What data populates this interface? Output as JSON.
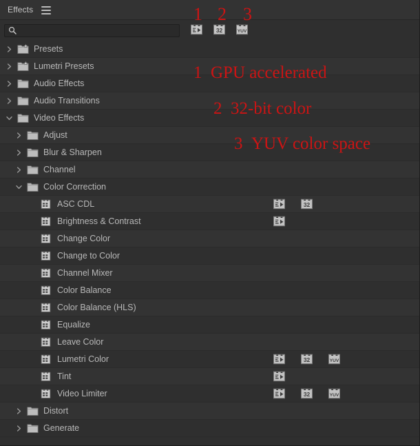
{
  "panel": {
    "title": "Effects",
    "menu_icon": "hamburger-menu-icon"
  },
  "search": {
    "value": "",
    "placeholder": "",
    "icon": "search-icon"
  },
  "filter_buttons": [
    {
      "id": "gpu",
      "icon": "gpu-accelerated-icon",
      "label": "GPU accelerated"
    },
    {
      "id": "bit32",
      "icon": "32-bit-color-icon",
      "label": "32-bit color"
    },
    {
      "id": "yuv",
      "icon": "yuv-color-space-icon",
      "label": "YUV color space"
    }
  ],
  "annotations": {
    "numbers": [
      "1",
      "2",
      "3"
    ],
    "lines": [
      {
        "num": "1",
        "text": "GPU accelerated"
      },
      {
        "num": "2",
        "text": "32-bit color"
      },
      {
        "num": "3",
        "text": "YUV color space"
      }
    ],
    "color": "#cc1414"
  },
  "tree": [
    {
      "label": "Presets",
      "kind": "preset-folder",
      "indent": 0,
      "twisty": "collapsed",
      "badges": []
    },
    {
      "label": "Lumetri Presets",
      "kind": "preset-folder",
      "indent": 0,
      "twisty": "collapsed",
      "badges": []
    },
    {
      "label": "Audio Effects",
      "kind": "folder",
      "indent": 0,
      "twisty": "collapsed",
      "badges": []
    },
    {
      "label": "Audio Transitions",
      "kind": "folder",
      "indent": 0,
      "twisty": "collapsed",
      "badges": []
    },
    {
      "label": "Video Effects",
      "kind": "folder",
      "indent": 0,
      "twisty": "expanded",
      "badges": []
    },
    {
      "label": "Adjust",
      "kind": "folder",
      "indent": 1,
      "twisty": "collapsed",
      "badges": []
    },
    {
      "label": "Blur & Sharpen",
      "kind": "folder",
      "indent": 1,
      "twisty": "collapsed",
      "badges": []
    },
    {
      "label": "Channel",
      "kind": "folder",
      "indent": 1,
      "twisty": "collapsed",
      "badges": []
    },
    {
      "label": "Color Correction",
      "kind": "folder",
      "indent": 1,
      "twisty": "expanded",
      "badges": []
    },
    {
      "label": "ASC CDL",
      "kind": "effect",
      "indent": 2,
      "twisty": "none",
      "badges": [
        "gpu",
        "bit32"
      ]
    },
    {
      "label": "Brightness & Contrast",
      "kind": "effect",
      "indent": 2,
      "twisty": "none",
      "badges": [
        "gpu"
      ]
    },
    {
      "label": "Change Color",
      "kind": "effect",
      "indent": 2,
      "twisty": "none",
      "badges": []
    },
    {
      "label": "Change to Color",
      "kind": "effect",
      "indent": 2,
      "twisty": "none",
      "badges": []
    },
    {
      "label": "Channel Mixer",
      "kind": "effect",
      "indent": 2,
      "twisty": "none",
      "badges": []
    },
    {
      "label": "Color Balance",
      "kind": "effect",
      "indent": 2,
      "twisty": "none",
      "badges": []
    },
    {
      "label": "Color Balance (HLS)",
      "kind": "effect",
      "indent": 2,
      "twisty": "none",
      "badges": []
    },
    {
      "label": "Equalize",
      "kind": "effect",
      "indent": 2,
      "twisty": "none",
      "badges": []
    },
    {
      "label": "Leave Color",
      "kind": "effect",
      "indent": 2,
      "twisty": "none",
      "badges": []
    },
    {
      "label": "Lumetri Color",
      "kind": "effect",
      "indent": 2,
      "twisty": "none",
      "badges": [
        "gpu",
        "bit32",
        "yuv"
      ]
    },
    {
      "label": "Tint",
      "kind": "effect",
      "indent": 2,
      "twisty": "none",
      "badges": [
        "gpu"
      ]
    },
    {
      "label": "Video Limiter",
      "kind": "effect",
      "indent": 2,
      "twisty": "none",
      "badges": [
        "gpu",
        "bit32",
        "yuv"
      ]
    },
    {
      "label": "Distort",
      "kind": "folder",
      "indent": 1,
      "twisty": "collapsed",
      "badges": []
    },
    {
      "label": "Generate",
      "kind": "folder",
      "indent": 1,
      "twisty": "collapsed",
      "badges": []
    }
  ]
}
